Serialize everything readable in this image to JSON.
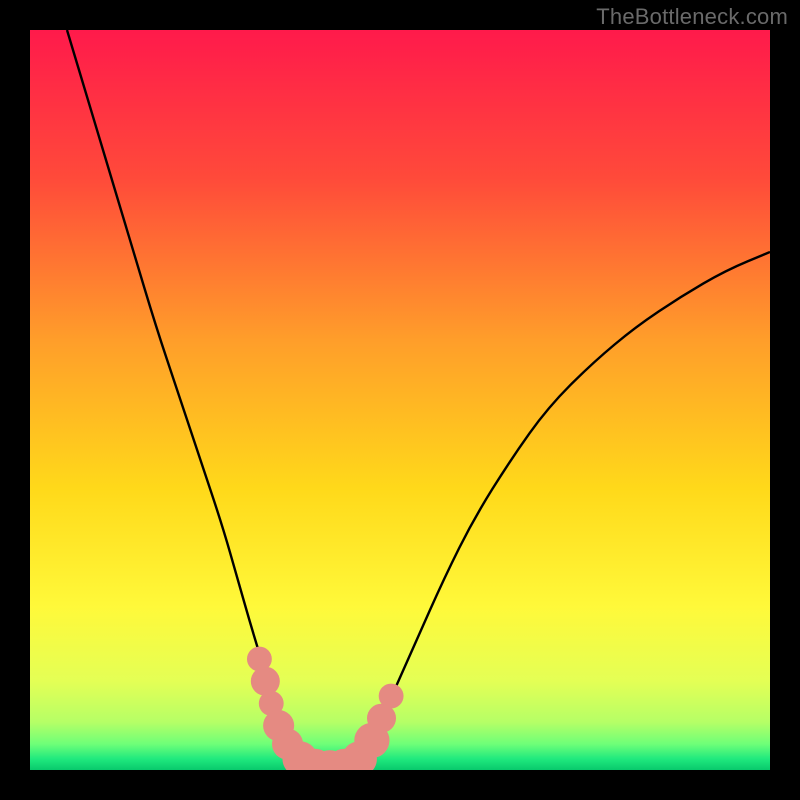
{
  "watermark": "TheBottleneck.com",
  "chart_data": {
    "type": "line",
    "title": "",
    "xlabel": "",
    "ylabel": "",
    "xlim": [
      0,
      100
    ],
    "ylim": [
      0,
      100
    ],
    "grid": false,
    "legend": false,
    "background_gradient": {
      "stops": [
        {
          "pos": 0.0,
          "color": "#ff1a4b"
        },
        {
          "pos": 0.2,
          "color": "#ff4a3a"
        },
        {
          "pos": 0.42,
          "color": "#ff9e2a"
        },
        {
          "pos": 0.62,
          "color": "#ffd91a"
        },
        {
          "pos": 0.78,
          "color": "#fff93a"
        },
        {
          "pos": 0.88,
          "color": "#e4ff55"
        },
        {
          "pos": 0.935,
          "color": "#b6ff66"
        },
        {
          "pos": 0.965,
          "color": "#6eff78"
        },
        {
          "pos": 0.985,
          "color": "#20e97e"
        },
        {
          "pos": 1.0,
          "color": "#08c96c"
        }
      ]
    },
    "series": [
      {
        "name": "bottleneck-curve",
        "color": "#000000",
        "x": [
          5,
          8,
          11,
          14,
          17,
          20,
          23,
          26,
          28,
          30,
          32,
          34,
          36,
          40,
          44,
          46,
          48,
          52,
          56,
          60,
          65,
          70,
          76,
          82,
          88,
          94,
          100
        ],
        "y": [
          100,
          90,
          80,
          70,
          60,
          51,
          42,
          33,
          26,
          19,
          12.5,
          7,
          3,
          0,
          0,
          3,
          8,
          17,
          26,
          34,
          42,
          49,
          55,
          60,
          64,
          67.5,
          70
        ]
      }
    ],
    "markers": {
      "name": "highlight-dots",
      "color": "#e58a82",
      "points": [
        {
          "x": 31.0,
          "y": 15.0,
          "r": 1.2
        },
        {
          "x": 31.8,
          "y": 12.0,
          "r": 1.4
        },
        {
          "x": 32.6,
          "y": 9.0,
          "r": 1.2
        },
        {
          "x": 33.6,
          "y": 6.0,
          "r": 1.5
        },
        {
          "x": 34.8,
          "y": 3.5,
          "r": 1.5
        },
        {
          "x": 36.5,
          "y": 1.5,
          "r": 1.7
        },
        {
          "x": 38.5,
          "y": 0.5,
          "r": 1.7
        },
        {
          "x": 40.5,
          "y": 0.3,
          "r": 1.7
        },
        {
          "x": 42.5,
          "y": 0.5,
          "r": 1.7
        },
        {
          "x": 44.5,
          "y": 1.5,
          "r": 1.7
        },
        {
          "x": 46.2,
          "y": 4.0,
          "r": 1.7
        },
        {
          "x": 47.5,
          "y": 7.0,
          "r": 1.4
        },
        {
          "x": 48.8,
          "y": 10.0,
          "r": 1.2
        }
      ]
    }
  }
}
